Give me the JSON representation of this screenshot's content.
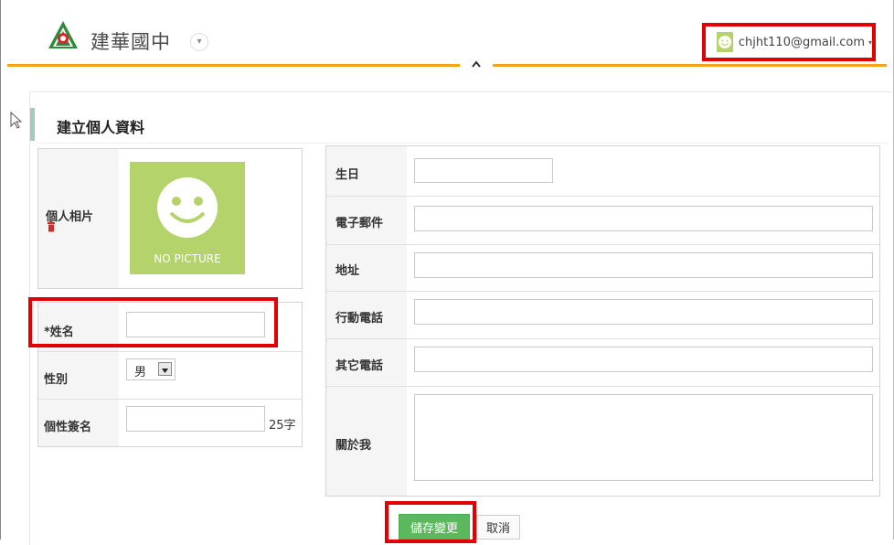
{
  "header": {
    "school_name": "建華國中",
    "school_caret": "▾",
    "user_email": "chjht110@gmail.com",
    "user_caret": "▾",
    "collapse_arrow": "⌃"
  },
  "page_title": "建立個人資料",
  "photo": {
    "label": "個人相片",
    "delete_icon": "trash-icon",
    "placeholder_text": "NO PICTURE"
  },
  "left_form": {
    "name_label": "*姓名",
    "name_value": "",
    "gender_label": "性別",
    "gender_selected": "男",
    "signature_label": "個性簽名",
    "signature_value": "",
    "signature_limit": "25字"
  },
  "right_form": {
    "birthday_label": "生日",
    "email_label": "電子郵件",
    "address_label": "地址",
    "mobile_label": "行動電話",
    "other_phone_label": "其它電話",
    "about_label": "關於我"
  },
  "buttons": {
    "save": "儲存變更",
    "cancel": "取消"
  },
  "colors": {
    "accent_orange": "#f5a21e",
    "highlight_red": "#e30000",
    "save_green": "#5cb85c",
    "avatar_green": "#b4d36b"
  }
}
